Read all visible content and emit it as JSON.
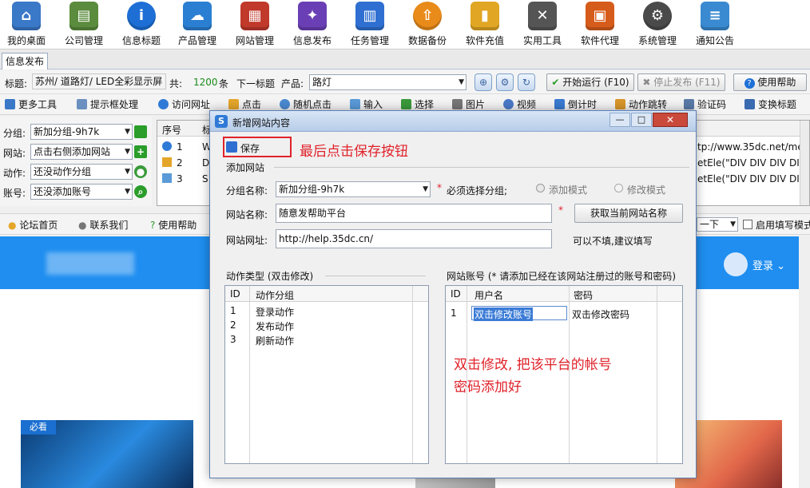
{
  "toolbar": {
    "items": [
      {
        "label": "我的桌面",
        "icon": "home-icon",
        "color": "#3a78c8"
      },
      {
        "label": "公司管理",
        "icon": "company-icon",
        "color": "#5b8b3c"
      },
      {
        "label": "信息标题",
        "icon": "info-icon",
        "color": "#1d6fd6"
      },
      {
        "label": "产品管理",
        "icon": "cloud-icon",
        "color": "#2b7fd3"
      },
      {
        "label": "网站管理",
        "icon": "website-icon",
        "color": "#c0392b"
      },
      {
        "label": "信息发布",
        "icon": "publish-wand-icon",
        "color": "#6a3fb5"
      },
      {
        "label": "任务管理",
        "icon": "chart-icon",
        "color": "#2f6fd1"
      },
      {
        "label": "数据备份",
        "icon": "backup-icon",
        "color": "#e98b1a"
      },
      {
        "label": "软件充值",
        "icon": "recharge-icon",
        "color": "#e1a623"
      },
      {
        "label": "实用工具",
        "icon": "tools-icon",
        "color": "#555555"
      },
      {
        "label": "软件代理",
        "icon": "agent-icon",
        "color": "#d65c1b"
      },
      {
        "label": "系统管理",
        "icon": "gear-icon",
        "color": "#4a4a4a"
      },
      {
        "label": "通知公告",
        "icon": "notice-icon",
        "color": "#3a8ad1"
      }
    ]
  },
  "tabs": {
    "active": "信息发布"
  },
  "row1": {
    "title_label": "标题:",
    "title_value": "苏州/ 道路灯/ LED全彩显示屏",
    "total_prefix": "共:",
    "total_count": "1200",
    "total_suffix": "条",
    "next_title": "下一标题",
    "product_label": "产品:",
    "product_value": "路灯",
    "start_run": "开始运行 (F10)",
    "stop_publish": "停止发布 (F11)",
    "help": "使用帮助"
  },
  "row2": {
    "items": [
      "更多工具",
      "提示框处理",
      "访问网址",
      "点击",
      "随机点击",
      "输入",
      "选择",
      "图片",
      "视频",
      "倒计时",
      "动作跳转",
      "验证码",
      "变换标题"
    ]
  },
  "left_panel": {
    "group_label": "分组:",
    "group_value": "新加分组-9h7k",
    "site_label": "网站:",
    "site_value": "点击右侧添加网站",
    "action_label": "动作:",
    "action_value": "还没动作分组",
    "account_label": "账号:",
    "account_value": "还没添加账号"
  },
  "list": {
    "header_no": "序号",
    "header_2": "标",
    "rows": [
      "1",
      "2",
      "3"
    ],
    "right_cells": [
      "tp://www.35dc.net/me",
      "etEle(\"DIV DIV DIV DIV",
      "etEle(\"DIV DIV DIV DIV"
    ],
    "row_letters": [
      "W",
      "D",
      "S"
    ]
  },
  "row3": {
    "forum": "论坛首页",
    "contact": "联系我们",
    "help": "使用帮助",
    "next_dd": "一下",
    "enable_mode": "启用填写模式"
  },
  "web": {
    "login": "登录",
    "must_see": "必看"
  },
  "dialog": {
    "title": "新增网站内容",
    "save": "保存",
    "section_add": "添加网站",
    "group_label": "分组名称:",
    "group_value": "新加分组-9h7k",
    "group_required": "必须选择分组;",
    "mode_add": "添加模式",
    "mode_edit": "修改模式",
    "site_name_label": "网站名称:",
    "site_name_value": "随意发帮助平台",
    "fetch_name_button": "获取当前网站名称",
    "site_url_label": "网站网址:",
    "site_url_value": "http://help.35dc.cn/",
    "url_hint": "可以不填,建议填写",
    "action_type_legend": "动作类型 (双击修改)",
    "action_table": {
      "headers": [
        "ID",
        "动作分组"
      ],
      "rows": [
        [
          "1",
          "登录动作"
        ],
        [
          "2",
          "发布动作"
        ],
        [
          "3",
          "刷新动作"
        ]
      ]
    },
    "account_legend": "网站账号 (* 请添加已经在该网站注册过的账号和密码)",
    "account_table": {
      "headers": [
        "ID",
        "用户名",
        "密码"
      ],
      "rows": [
        [
          "1",
          "双击修改账号",
          "双击修改密码"
        ]
      ]
    }
  },
  "annotations": {
    "save_hint": "最后点击保存按钮",
    "edit_hint_line1": "双击修改, 把该平台的帐号",
    "edit_hint_line2": "密码添加好"
  },
  "colors": {
    "annotation_red": "#e0222a",
    "site_header_blue": "#1f8ef0",
    "accent_green": "#2a9d2a"
  }
}
